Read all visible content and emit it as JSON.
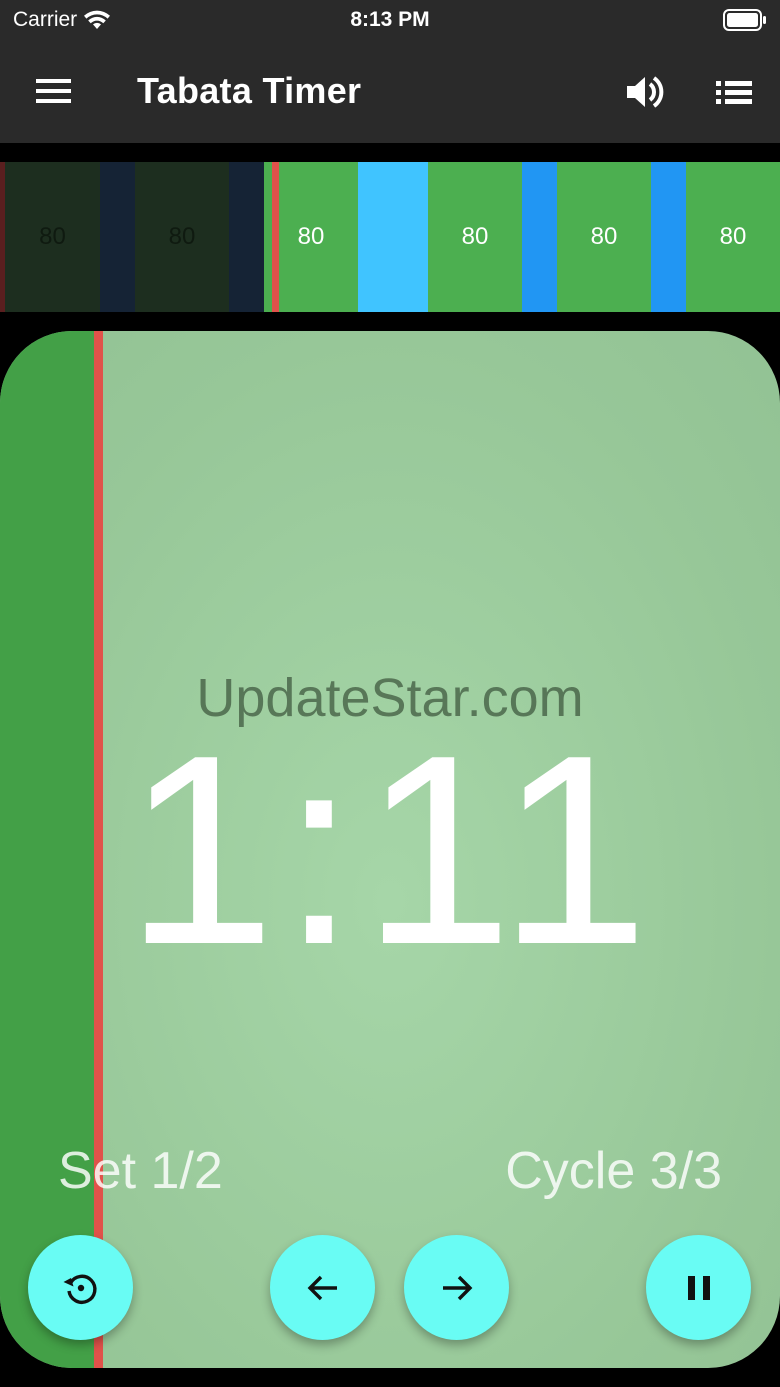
{
  "status_bar": {
    "carrier": "Carrier",
    "time": "8:13 PM"
  },
  "app_bar": {
    "title": "Tabata Timer"
  },
  "timeline": {
    "segments": [
      {
        "label": "80",
        "color": "#1d2e1f",
        "label_color": "#0f1a10"
      },
      {
        "label": "",
        "color": "#152335"
      },
      {
        "label": "80",
        "color": "#1d2e1f",
        "label_color": "#0f1a10"
      },
      {
        "label": "",
        "color": "#152335"
      },
      {
        "label": "80",
        "color": "#4caf50",
        "label_color": "#ffffff"
      },
      {
        "label": "",
        "color": "#40c4ff"
      },
      {
        "label": "80",
        "color": "#4caf50",
        "label_color": "#ffffff"
      },
      {
        "label": "",
        "color": "#2196f3"
      },
      {
        "label": "80",
        "color": "#4caf50",
        "label_color": "#ffffff"
      },
      {
        "label": "",
        "color": "#2196f3"
      },
      {
        "label": "80",
        "color": "#4caf50",
        "label_color": "#ffffff"
      }
    ]
  },
  "main": {
    "watermark": "UpdateStar.com",
    "countdown": "1:11",
    "set_text": "Set 1/2",
    "cycle_text": "Cycle 3/3",
    "progress_fraction": 0.12
  },
  "colors": {
    "accent": "#69fcf4",
    "progress_fill": "#43a047",
    "progress_marker": "#e0524a",
    "app_bar_bg": "#2a2a2a"
  },
  "icons": {
    "menu": "menu-icon",
    "volume": "volume-up-icon",
    "list": "list-icon",
    "reset": "restore-icon",
    "previous": "arrow-left-icon",
    "next": "arrow-right-icon",
    "pause": "pause-icon"
  }
}
